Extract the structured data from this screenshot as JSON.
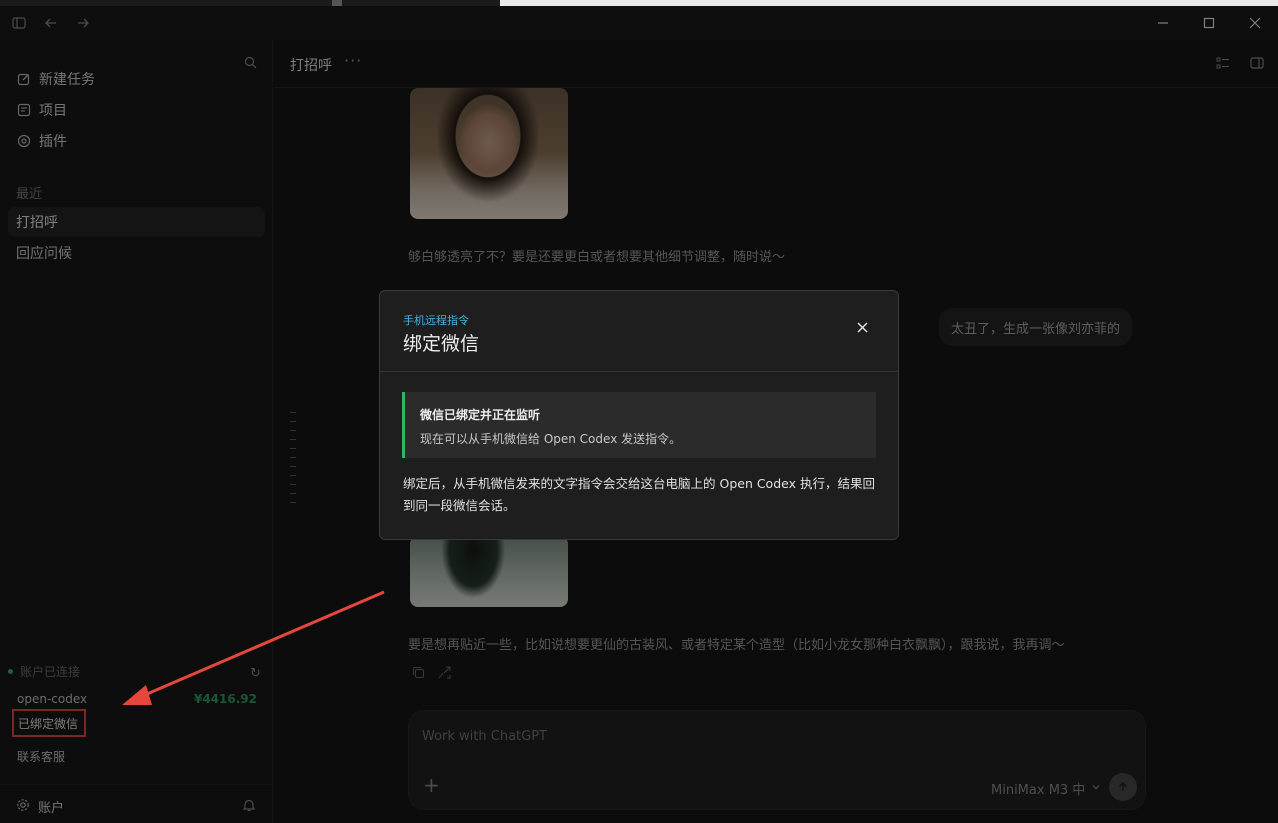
{
  "sidebar": {
    "nav": [
      {
        "label": "新建任务",
        "icon": "edit-icon"
      },
      {
        "label": "项目",
        "icon": "project-icon"
      },
      {
        "label": "插件",
        "icon": "plugin-icon"
      }
    ],
    "recent_label": "最近",
    "recent": [
      {
        "label": "打招呼",
        "active": true
      },
      {
        "label": "回应问候",
        "active": false
      }
    ],
    "account_status": "账户已连接",
    "account_name": "open-codex",
    "balance": "¥4416.92",
    "wechat_bound": "已绑定微信",
    "support": "联系客服",
    "account_label": "账户"
  },
  "header": {
    "title": "打招呼",
    "more": "···"
  },
  "chat": {
    "assistant_msg_1": "够白够透亮了不？要是还要更白或者想要其他细节调整，随时说～",
    "user_msg": "太丑了，生成一张像刘亦菲的",
    "assistant_msg_2": "要是想再贴近一些，比如说想要更仙的古装风、或者特定某个造型（比如小龙女那种白衣飘飘），跟我说，我再调～"
  },
  "composer": {
    "placeholder": "Work with ChatGPT",
    "model": "MiniMax M3 中"
  },
  "modal": {
    "kicker": "手机远程指令",
    "title": "绑定微信",
    "notice_title": "微信已绑定并正在监听",
    "notice_body": "现在可以从手机微信给 Open Codex 发送指令。",
    "description": "绑定后，从手机微信发来的文字指令会交给这台电脑上的 Open Codex 执行，结果回到同一段微信会话。"
  },
  "colors": {
    "accent_blue": "#43b4e0",
    "success_green": "#2fb46a",
    "balance_green": "#2f9e63",
    "annotation_red": "#e5473d"
  }
}
